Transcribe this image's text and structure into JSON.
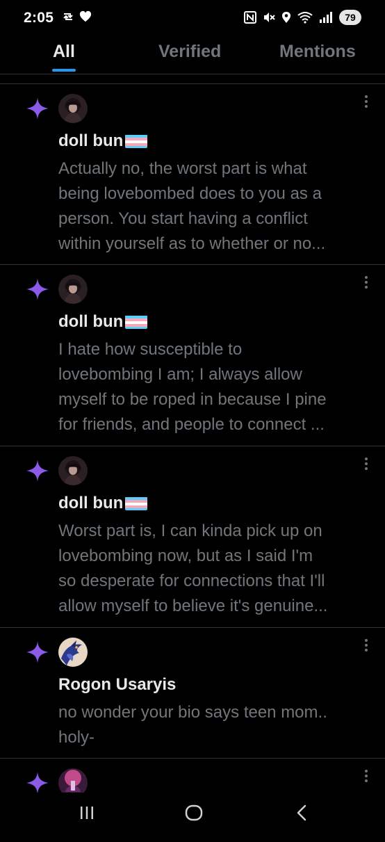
{
  "status_bar": {
    "time": "2:05",
    "battery": "79"
  },
  "tabs": [
    {
      "label": "All",
      "active": true
    },
    {
      "label": "Verified",
      "active": false
    },
    {
      "label": "Mentions",
      "active": false
    }
  ],
  "colors": {
    "accent": "#1d9bf0",
    "sparkle": "#8c5ae8",
    "muted_text": "#71767b",
    "primary_text": "#e7e9ea",
    "divider": "#2f3336"
  },
  "notifications": [
    {
      "icon": "sparkle-icon",
      "author": "doll bun",
      "flag": "trans-flag",
      "lines": [
        "Actually no, the worst part is what",
        "being lovebombed does to you as a",
        "person. You start having a conflict",
        "within yourself as to whether or no..."
      ]
    },
    {
      "icon": "sparkle-icon",
      "author": "doll bun",
      "flag": "trans-flag",
      "lines": [
        "I hate how susceptible to",
        "lovebombing I am; I always allow",
        "myself to be roped in because I pine",
        "for friends, and people to connect ..."
      ]
    },
    {
      "icon": "sparkle-icon",
      "author": "doll bun",
      "flag": "trans-flag",
      "lines": [
        "Worst part is, I can kinda pick up on",
        "lovebombing now, but as I said I'm",
        "so desperate for connections that I'll",
        "allow myself to believe it's genuine..."
      ]
    },
    {
      "icon": "sparkle-icon",
      "author": "Rogon Usaryis",
      "lines": [
        "no wonder your bio says teen mom..",
        "holy-"
      ]
    }
  ]
}
